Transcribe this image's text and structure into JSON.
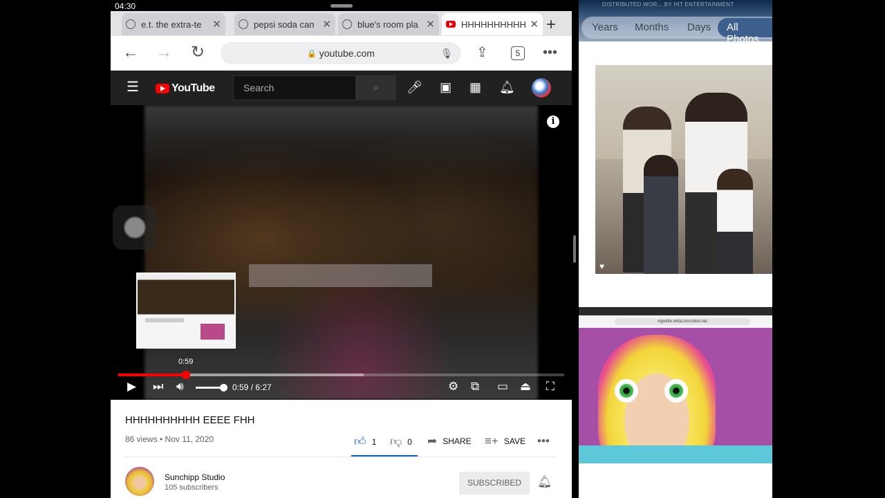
{
  "status_bar": {
    "time": "04:30"
  },
  "safari": {
    "tabs": [
      {
        "title": "e.t. the extra-te",
        "icon": "globe-icon"
      },
      {
        "title": "pepsi soda can",
        "icon": "globe-icon"
      },
      {
        "title": "blue's room pla",
        "icon": "globe-icon"
      },
      {
        "title": "HHHHHHHHHH",
        "icon": "youtube-favicon",
        "active": true
      }
    ],
    "new_tab": "+",
    "address": "youtube.com",
    "tab_count": "5"
  },
  "youtube": {
    "logo": "YouTube",
    "search_placeholder": "Search",
    "player": {
      "current_time": "0:59",
      "duration": "6:27",
      "time_display": "0:59 / 6:27",
      "preview_time": "0:59",
      "progress_fraction": 0.152,
      "buffered_fraction": 0.55,
      "volume_fraction": 0.85
    },
    "video": {
      "title": "HHHHHHHHHH EEEE FHH",
      "meta": "86 views • Nov 11, 2020",
      "likes": "1",
      "dislikes": "0",
      "share": "SHARE",
      "save": "SAVE"
    },
    "channel": {
      "name": "Sunchipp Studio",
      "subscribers": "105 subscribers",
      "subscribe_label": "SUBSCRIBED"
    },
    "colors": {
      "accent": "#ff0000",
      "like_blue": "#065fd4",
      "header_bg": "#212121"
    }
  },
  "photos": {
    "credit": "DISTRIBUTED WOR... BY HIT ENTERTAINMENT",
    "segments": [
      "Years",
      "Months",
      "Days",
      "All Photos"
    ],
    "active_segment": "All Photos",
    "screenshot_url": "vignette.wikia.nocookie.net"
  }
}
